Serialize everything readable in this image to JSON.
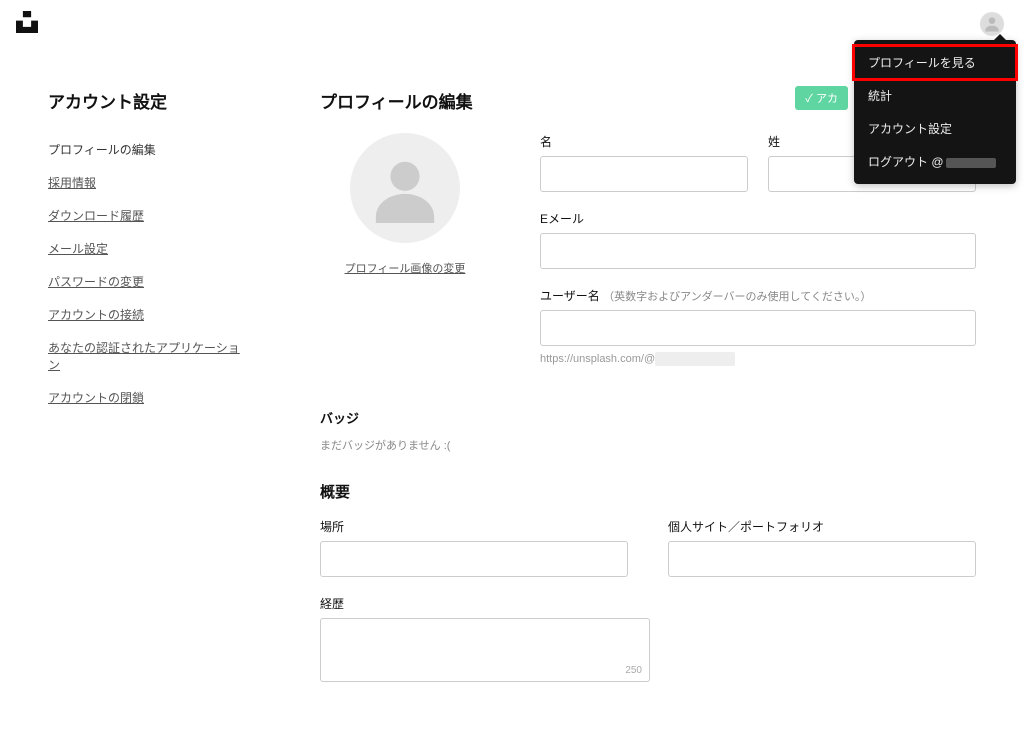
{
  "header": {
    "logo_name": "unsplash-logo"
  },
  "popover": {
    "items": [
      {
        "id": "view-profile",
        "label": "プロフィールを見る",
        "highlight": true
      },
      {
        "id": "stats",
        "label": "統計"
      },
      {
        "id": "account-settings",
        "label": "アカウント設定"
      },
      {
        "id": "logout",
        "label": "ログアウト @"
      }
    ]
  },
  "toast": {
    "text": "アカ"
  },
  "sidebar": {
    "title": "アカウント設定",
    "links": [
      {
        "id": "edit-profile",
        "label": "プロフィールの編集",
        "current": true
      },
      {
        "id": "hiring",
        "label": "採用情報"
      },
      {
        "id": "download-history",
        "label": "ダウンロード履歴"
      },
      {
        "id": "email-settings",
        "label": "メール設定"
      },
      {
        "id": "change-password",
        "label": "パスワードの変更"
      },
      {
        "id": "connections",
        "label": "アカウントの接続"
      },
      {
        "id": "authorized-apps",
        "label": "あなたの認証されたアプリケーション"
      },
      {
        "id": "close-account",
        "label": "アカウントの閉鎖"
      }
    ]
  },
  "main": {
    "title": "プロフィールの編集",
    "change_photo": "プロフィール画像の変更",
    "labels": {
      "first_name": "名",
      "last_name": "姓",
      "email": "Eメール",
      "username": "ユーザー名",
      "username_hint": "（英数字およびアンダーバーのみ使用してください。）",
      "url_prefix": "https://unsplash.com/@",
      "badge": "バッジ",
      "badge_none": "まだバッジがありません :(",
      "overview": "概要",
      "location": "場所",
      "personal_site": "個人サイト／ポートフォリオ",
      "bio": "経歴",
      "bio_limit": "250"
    },
    "values": {
      "first_name": "",
      "last_name": "",
      "email": "",
      "username": "",
      "location": "",
      "personal_site": "",
      "bio": ""
    }
  }
}
